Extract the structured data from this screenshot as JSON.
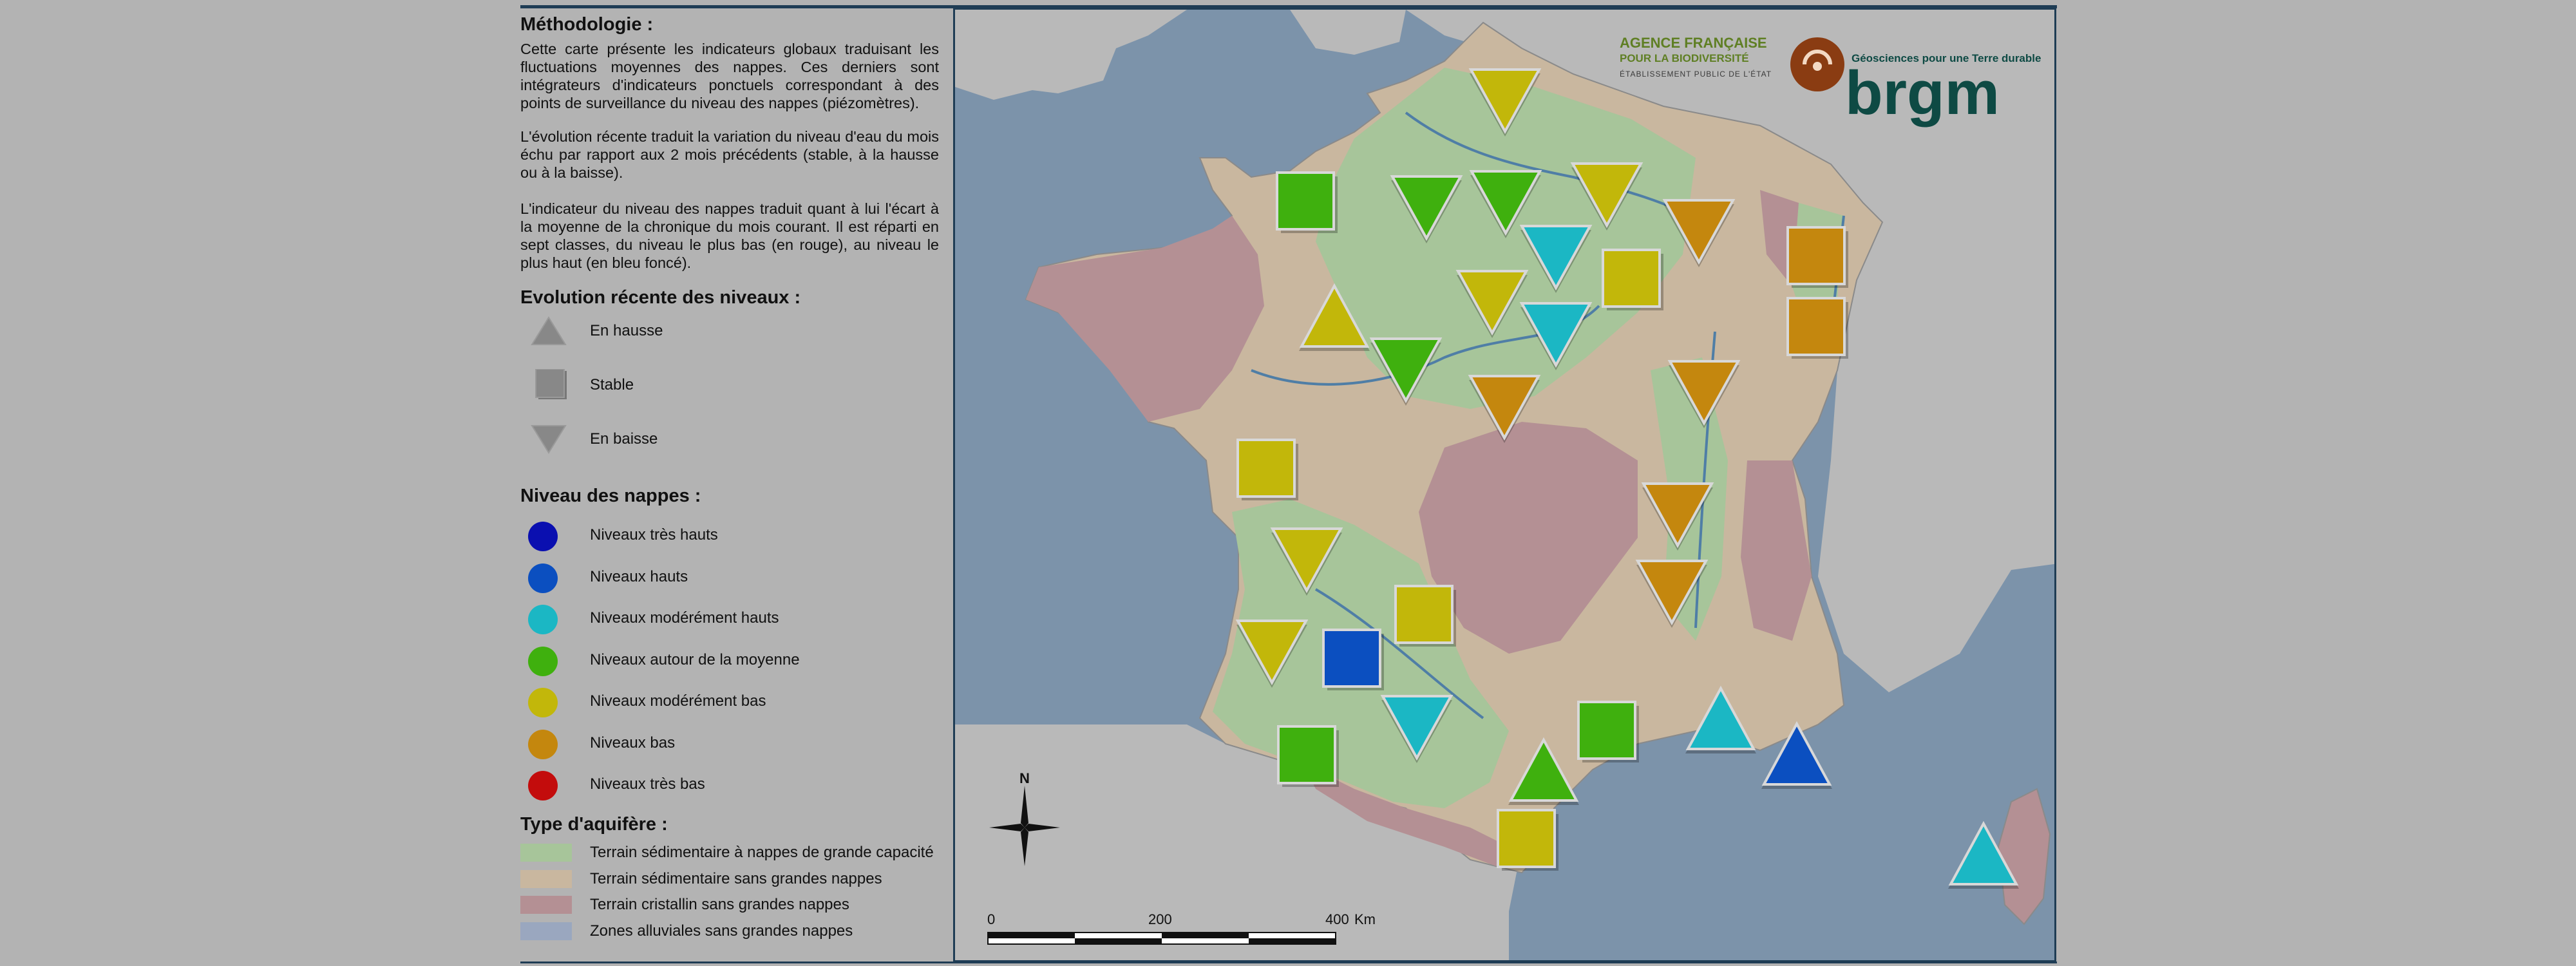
{
  "legend": {
    "methodologie_title": "Méthodologie :",
    "methodologie_p1": "Cette carte présente les indicateurs globaux traduisant les fluctuations moyennes des nappes. Ces derniers sont intégrateurs d'indicateurs ponctuels correspondant à des points de surveillance du niveau des nappes (piézomètres).",
    "methodologie_p2": "L'évolution récente traduit la variation du niveau d'eau du mois échu par rapport aux 2 mois précédents (stable, à la hausse ou à la baisse).",
    "methodologie_p3": "L'indicateur du niveau des nappes traduit quant à lui l'écart à la moyenne de la chronique du mois courant. Il est réparti en sept classes, du niveau le plus bas (en rouge), au niveau le plus haut (en bleu foncé).",
    "evolution_title": "Evolution récente des niveaux :",
    "evolution_items": [
      {
        "label": "En hausse",
        "shape": "triangle-up"
      },
      {
        "label": "Stable",
        "shape": "square"
      },
      {
        "label": "En baisse",
        "shape": "triangle-down"
      }
    ],
    "niveau_title": "Niveau des nappes :",
    "niveau_items": [
      {
        "label": "Niveaux très hauts",
        "color": "#0a0fb0"
      },
      {
        "label": "Niveaux hauts",
        "color": "#0b4fc0"
      },
      {
        "label": "Niveaux modérément hauts",
        "color": "#1bb7c4"
      },
      {
        "label": "Niveaux autour de la moyenne",
        "color": "#3fb00e"
      },
      {
        "label": "Niveaux modérément bas",
        "color": "#c2b70a"
      },
      {
        "label": "Niveaux bas",
        "color": "#c4870e"
      },
      {
        "label": "Niveaux très bas",
        "color": "#c30c0c"
      }
    ],
    "aquifere_title": "Type d'aquifère :",
    "aquifere_items": [
      {
        "label": "Terrain sédimentaire à nappes de grande capacité",
        "color": "#a7c59a"
      },
      {
        "label": "Terrain sédimentaire sans grandes nappes",
        "color": "#c9b79f"
      },
      {
        "label": "Terrain cristallin sans grandes nappes",
        "color": "#b49094"
      },
      {
        "label": "Zones alluviales sans grandes nappes",
        "color": "#9aa7bf"
      }
    ]
  },
  "map": {
    "colors": {
      "sea": "#7c93aa",
      "land_outside": "#b9b9b9",
      "sedimentaire_grande": "#a7c59a",
      "sedimentaire_sans": "#c9b79f",
      "cristallin": "#b49094",
      "alluviales": "#9aa7bf",
      "river": "#4f7ea6"
    },
    "indicators": [
      {
        "region": "north-flandres",
        "shape": "triangle-down",
        "level": "Niveaux modérément bas"
      },
      {
        "region": "normandie-west",
        "shape": "square",
        "level": "Niveaux autour de la moyenne"
      },
      {
        "region": "normandie-east",
        "shape": "triangle-down",
        "level": "Niveaux autour de la moyenne"
      },
      {
        "region": "picardie",
        "shape": "triangle-down",
        "level": "Niveaux autour de la moyenne"
      },
      {
        "region": "champagne-north",
        "shape": "triangle-down",
        "level": "Niveaux modérément bas"
      },
      {
        "region": "lorraine",
        "shape": "triangle-down",
        "level": "Niveaux bas"
      },
      {
        "region": "alsace-north",
        "shape": "square",
        "level": "Niveaux bas"
      },
      {
        "region": "alsace-south",
        "shape": "square",
        "level": "Niveaux bas"
      },
      {
        "region": "ile-de-france",
        "shape": "triangle-down",
        "level": "Niveaux modérément hauts"
      },
      {
        "region": "champagne-south",
        "shape": "square",
        "level": "Niveaux modérément bas"
      },
      {
        "region": "beauce",
        "shape": "triangle-down",
        "level": "Niveaux modérément bas"
      },
      {
        "region": "maine",
        "shape": "triangle-up",
        "level": "Niveaux modérément bas"
      },
      {
        "region": "touraine",
        "shape": "triangle-down",
        "level": "Niveaux autour de la moyenne"
      },
      {
        "region": "sologne",
        "shape": "triangle-down",
        "level": "Niveaux modérément hauts"
      },
      {
        "region": "berry",
        "shape": "triangle-down",
        "level": "Niveaux bas"
      },
      {
        "region": "franche-comte",
        "shape": "triangle-down",
        "level": "Niveaux bas"
      },
      {
        "region": "vendee",
        "shape": "square",
        "level": "Niveaux modérément bas"
      },
      {
        "region": "charentes",
        "shape": "triangle-down",
        "level": "Niveaux modérément bas"
      },
      {
        "region": "perigord",
        "shape": "square",
        "level": "Niveaux modérément bas"
      },
      {
        "region": "bresse",
        "shape": "triangle-down",
        "level": "Niveaux bas"
      },
      {
        "region": "rhone",
        "shape": "triangle-down",
        "level": "Niveaux bas"
      },
      {
        "region": "landes-north",
        "shape": "triangle-down",
        "level": "Niveaux modérément bas"
      },
      {
        "region": "aquitaine",
        "shape": "square",
        "level": "Niveaux hauts"
      },
      {
        "region": "quercy",
        "shape": "triangle-down",
        "level": "Niveaux modérément hauts"
      },
      {
        "region": "landes-south",
        "shape": "square",
        "level": "Niveaux autour de la moyenne"
      },
      {
        "region": "languedoc",
        "shape": "square",
        "level": "Niveaux autour de la moyenne"
      },
      {
        "region": "toulouse",
        "shape": "triangle-up",
        "level": "Niveaux autour de la moyenne"
      },
      {
        "region": "provence",
        "shape": "triangle-up",
        "level": "Niveaux modérément hauts"
      },
      {
        "region": "cote-azur",
        "shape": "triangle-up",
        "level": "Niveaux hauts"
      },
      {
        "region": "roussillon",
        "shape": "square",
        "level": "Niveaux modérément bas"
      },
      {
        "region": "corse",
        "shape": "triangle-up",
        "level": "Niveaux modérément hauts"
      }
    ],
    "compass": {
      "north_label": "N"
    },
    "scale": {
      "ticks": [
        "0",
        "200",
        "400"
      ],
      "unit": "Km"
    },
    "logos": {
      "afb_line1": "AGENCE FRANÇAISE",
      "afb_line2": "POUR LA BIODIVERSITÉ",
      "afb_line3": "ÉTABLISSEMENT PUBLIC DE L'ÉTAT",
      "brgm_tagline": "Géosciences pour une Terre durable",
      "brgm_name": "brgm"
    }
  }
}
